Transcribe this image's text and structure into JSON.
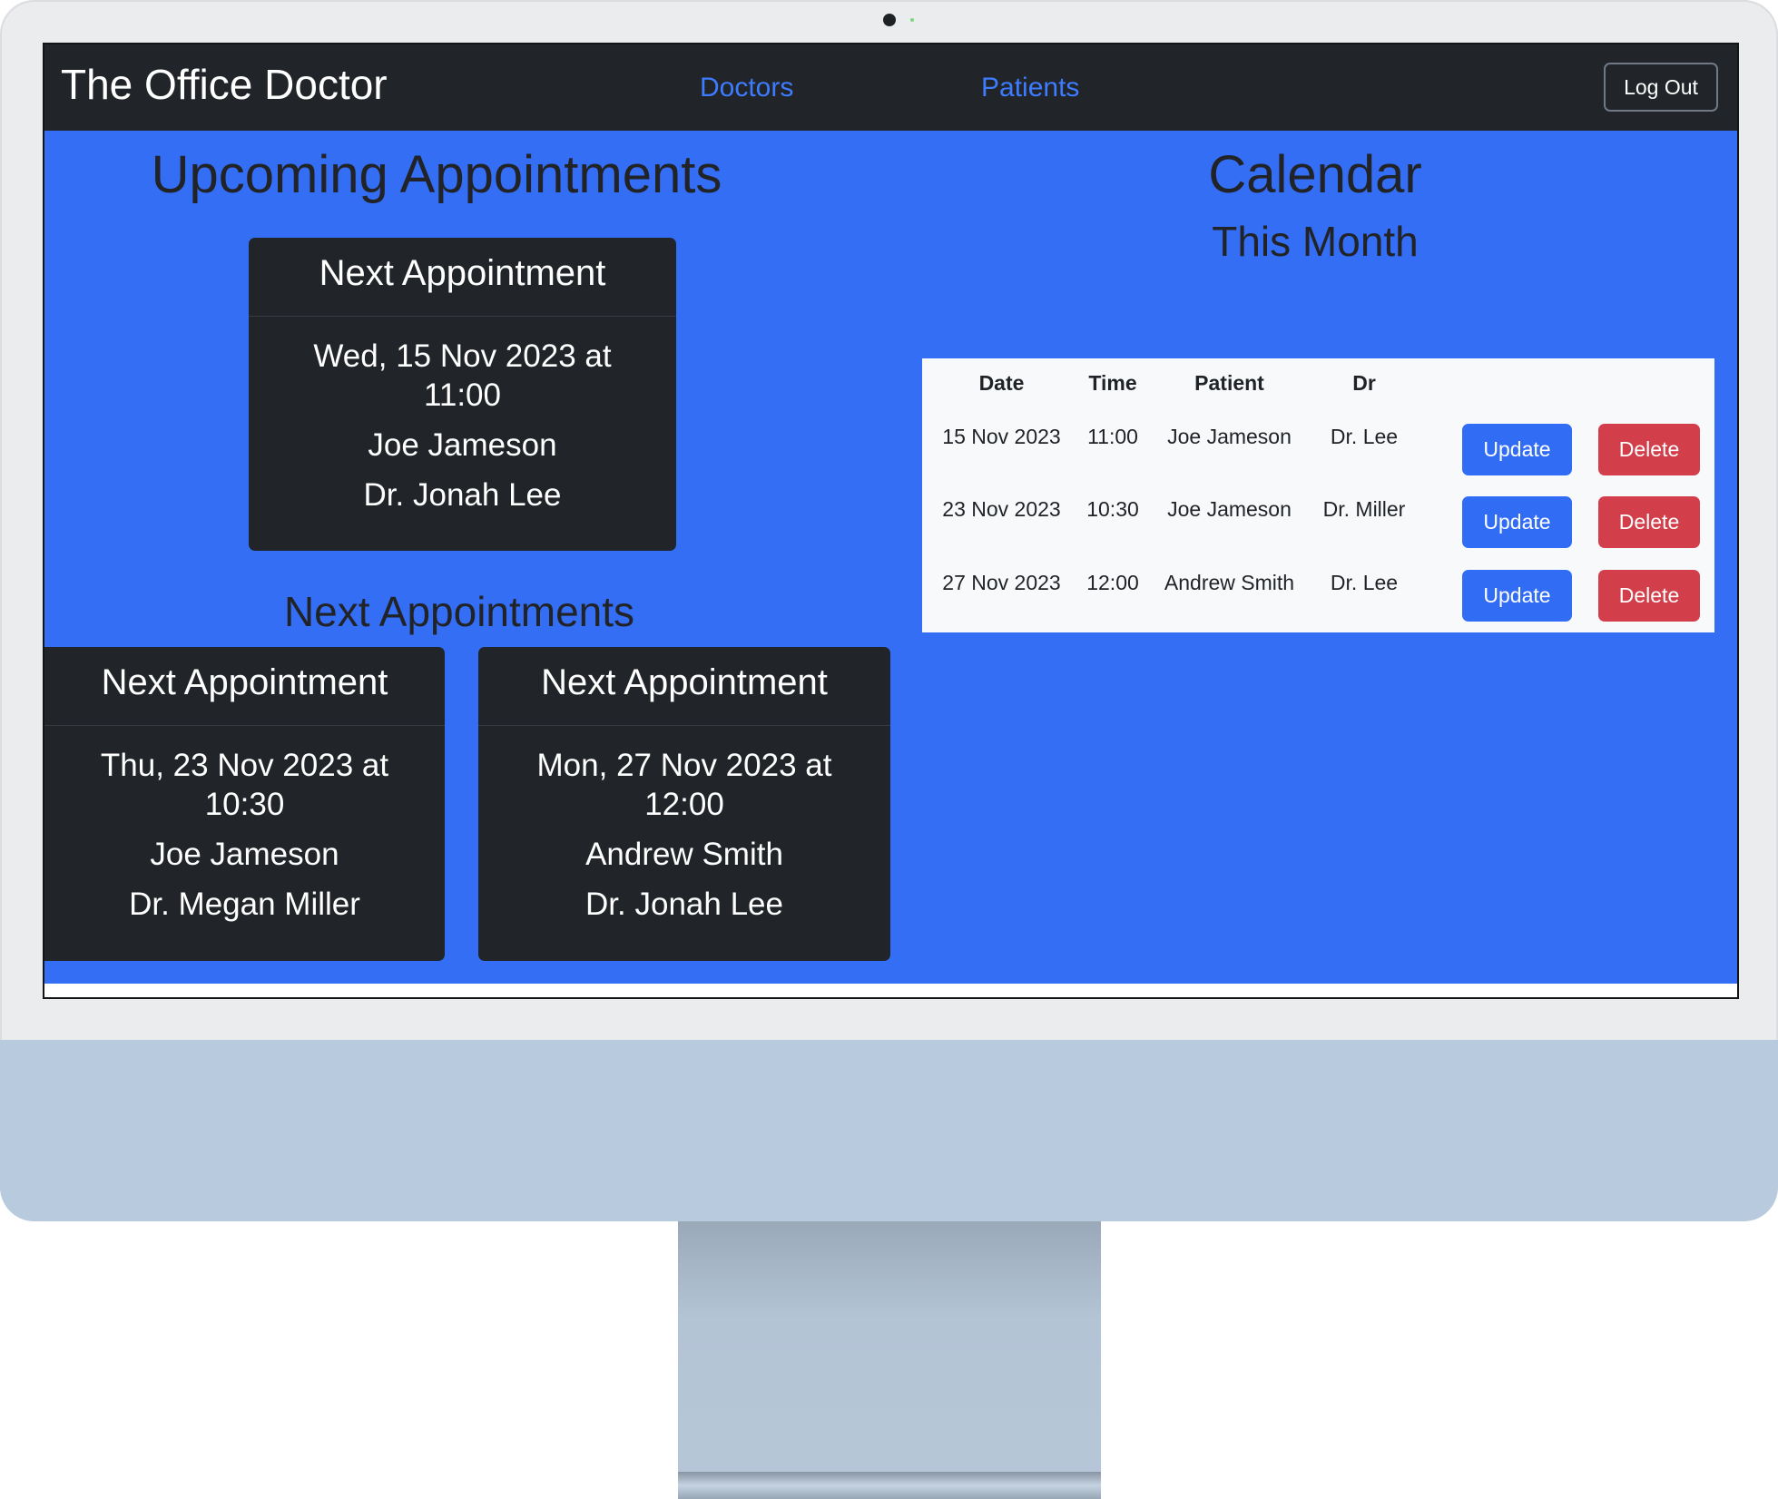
{
  "app": {
    "brand": "The Office Doctor",
    "nav": [
      {
        "label": "Doctors"
      },
      {
        "label": "Patients"
      }
    ],
    "logout_label": "Log Out"
  },
  "upcoming": {
    "title": "Upcoming Appointments",
    "featured": {
      "header": "Next Appointment",
      "when": "Wed, 15 Nov 2023 at 11:00",
      "patient": "Joe Jameson",
      "doctor": "Dr. Jonah Lee"
    },
    "next_title": "Next Appointments",
    "cards": [
      {
        "header": "Next Appointment",
        "when": "Thu, 23 Nov 2023 at 10:30",
        "patient": "Joe Jameson",
        "doctor": "Dr. Megan Miller"
      },
      {
        "header": "Next Appointment",
        "when": "Mon, 27 Nov 2023 at 12:00",
        "patient": "Andrew Smith",
        "doctor": "Dr. Jonah Lee"
      }
    ]
  },
  "calendar": {
    "title": "Calendar",
    "subtitle": "This Month",
    "columns": [
      "Date",
      "Time",
      "Patient",
      "Dr"
    ],
    "rows": [
      {
        "date": "15 Nov 2023",
        "time": "11:00",
        "patient": "Joe Jameson",
        "doctor": "Dr. Lee",
        "update_label": "Update",
        "delete_label": "Delete"
      },
      {
        "date": "23 Nov 2023",
        "time": "10:30",
        "patient": "Joe Jameson",
        "doctor": "Dr. Miller",
        "update_label": "Update",
        "delete_label": "Delete"
      },
      {
        "date": "27 Nov 2023",
        "time": "12:00",
        "patient": "Andrew Smith",
        "doctor": "Dr. Lee",
        "update_label": "Update",
        "delete_label": "Delete"
      }
    ]
  },
  "colors": {
    "navbar": "#212529",
    "page_background": "#336ef4",
    "card": "#212529",
    "link": "#3d7bff",
    "update_button": "#316cf4",
    "delete_button": "#d23e4a"
  }
}
